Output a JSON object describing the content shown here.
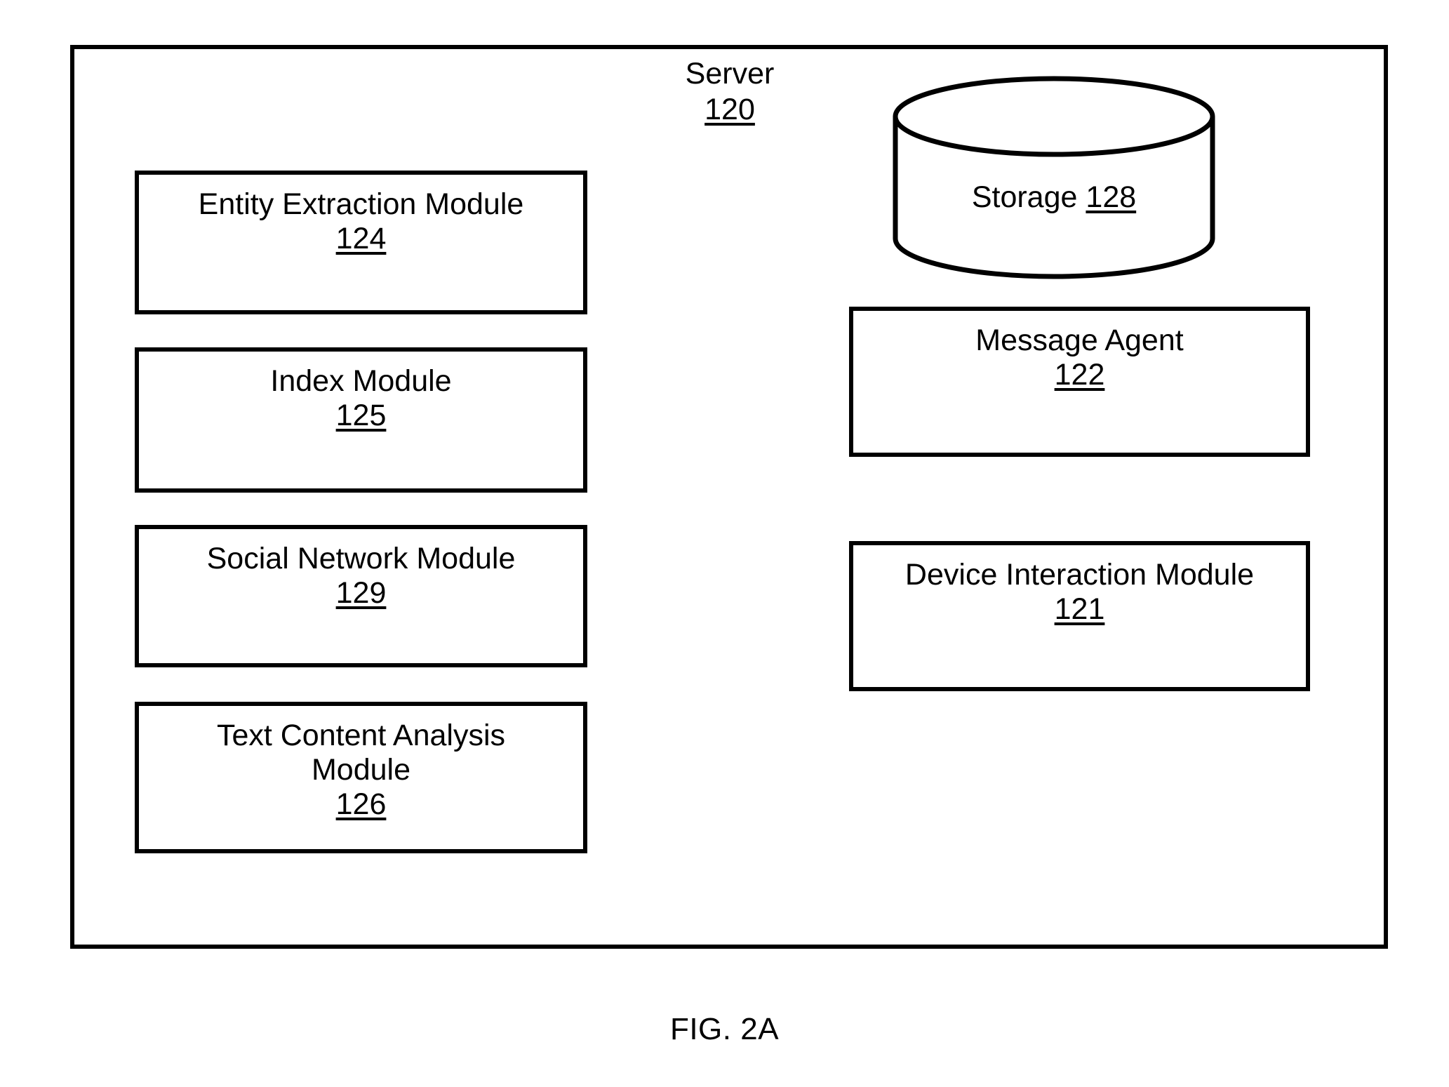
{
  "figure": {
    "caption": "FIG. 2A"
  },
  "server": {
    "label": "Server",
    "ref": "120"
  },
  "storage": {
    "label": "Storage",
    "ref": "128"
  },
  "left_modules": [
    {
      "name": "entity-extraction-module",
      "line1": "Entity Extraction Module",
      "ref": "124"
    },
    {
      "name": "index-module",
      "line1": "Index Module",
      "ref": "125"
    },
    {
      "name": "social-network-module",
      "line1": "Social Network Module",
      "ref": "129"
    },
    {
      "name": "text-content-analysis-module",
      "line1": "Text Content Analysis",
      "line2": "Module",
      "ref": "126"
    }
  ],
  "right_modules": [
    {
      "name": "message-agent",
      "line1": "Message Agent",
      "ref": "122"
    },
    {
      "name": "device-interaction-module",
      "line1": "Device Interaction Module",
      "ref": "121"
    }
  ],
  "colors": {
    "stroke": "#000000",
    "background": "#ffffff"
  }
}
